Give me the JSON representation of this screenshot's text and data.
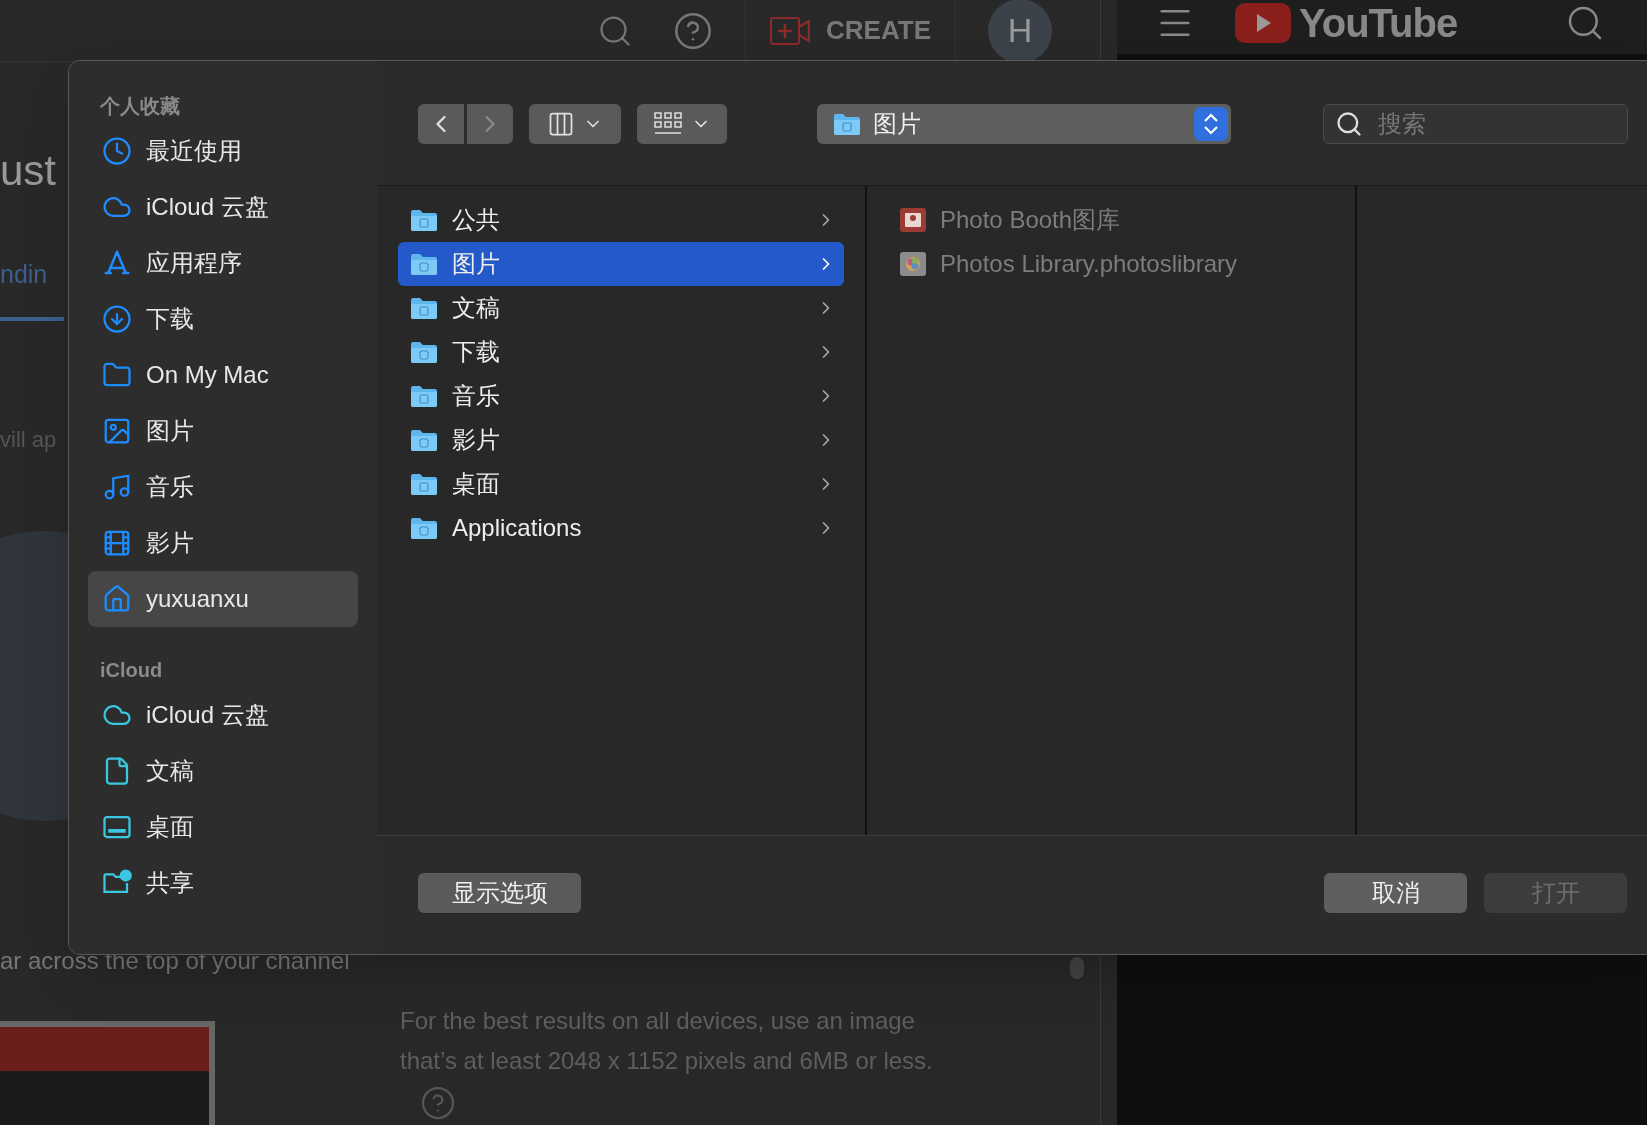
{
  "background": {
    "header": {
      "create_label": "CREATE",
      "avatar": "H",
      "logo": "YouTube"
    },
    "fragments": [
      {
        "text": "ust",
        "kind": "title"
      },
      {
        "text": "ndin",
        "kind": "tab"
      },
      {
        "text": "vill ap",
        "kind": "body"
      }
    ],
    "caption": "ar across the top of your channel",
    "hint_lines": [
      "For the best results on all devices, use an image",
      "that’s at least 2048 x 1152 pixels and 6MB or less."
    ]
  },
  "dialog": {
    "sidebar": [
      {
        "title": "个人收藏",
        "items": [
          {
            "label": "最近使用",
            "selected": false
          },
          {
            "label": "iCloud 云盘",
            "selected": false
          },
          {
            "label": "应用程序",
            "selected": false
          },
          {
            "label": "下载",
            "selected": false
          },
          {
            "label": "On My Mac",
            "selected": false
          },
          {
            "label": "图片",
            "selected": false
          },
          {
            "label": "音乐",
            "selected": false
          },
          {
            "label": "影片",
            "selected": false
          },
          {
            "label": "yuxuanxu",
            "selected": true
          }
        ]
      },
      {
        "title": "iCloud",
        "items": [
          {
            "label": "iCloud 云盘",
            "selected": false
          },
          {
            "label": "文稿",
            "selected": false
          },
          {
            "label": "桌面",
            "selected": false
          },
          {
            "label": "共享",
            "selected": false
          }
        ]
      }
    ],
    "toolbar": {
      "back_disabled": false,
      "forward_disabled": true,
      "path": "图片",
      "search_placeholder": "搜索"
    },
    "column_1": [
      {
        "label": "公共",
        "selected": false
      },
      {
        "label": "图片",
        "selected": true
      },
      {
        "label": "文稿",
        "selected": false
      },
      {
        "label": "下载",
        "selected": false
      },
      {
        "label": "音乐",
        "selected": false
      },
      {
        "label": "影片",
        "selected": false
      },
      {
        "label": "桌面",
        "selected": false
      },
      {
        "label": "Applications",
        "selected": false
      }
    ],
    "column_2": [
      {
        "label": "Photo Booth图库",
        "disabled": true
      },
      {
        "label": "Photos Library.photoslibrary",
        "disabled": true
      }
    ],
    "options_button": "显示选项",
    "actions": [
      {
        "label": "取消",
        "disabled": false
      },
      {
        "label": "打开",
        "disabled": true
      }
    ]
  }
}
